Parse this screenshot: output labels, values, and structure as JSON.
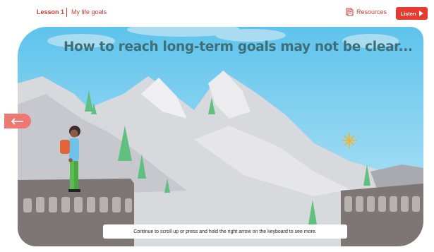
{
  "header": {
    "lesson_label": "Lesson 1",
    "lesson_title": "My life goals",
    "resources_label": "Resources",
    "listen_label": "Listen"
  },
  "scene": {
    "headline": "How to reach long-term goals may not be clear..."
  },
  "footer": {
    "instruction": "Continue to scroll up or press and hold the right arrow on the keyboard to see more."
  },
  "icons": {
    "back": "arrow-left-icon",
    "resources": "document-icon",
    "listen": "play-icon"
  },
  "colors": {
    "accent": "#e63b2f",
    "back_button": "#ee7873",
    "headline": "#3e6f78",
    "sky": "#5ec3ec"
  }
}
